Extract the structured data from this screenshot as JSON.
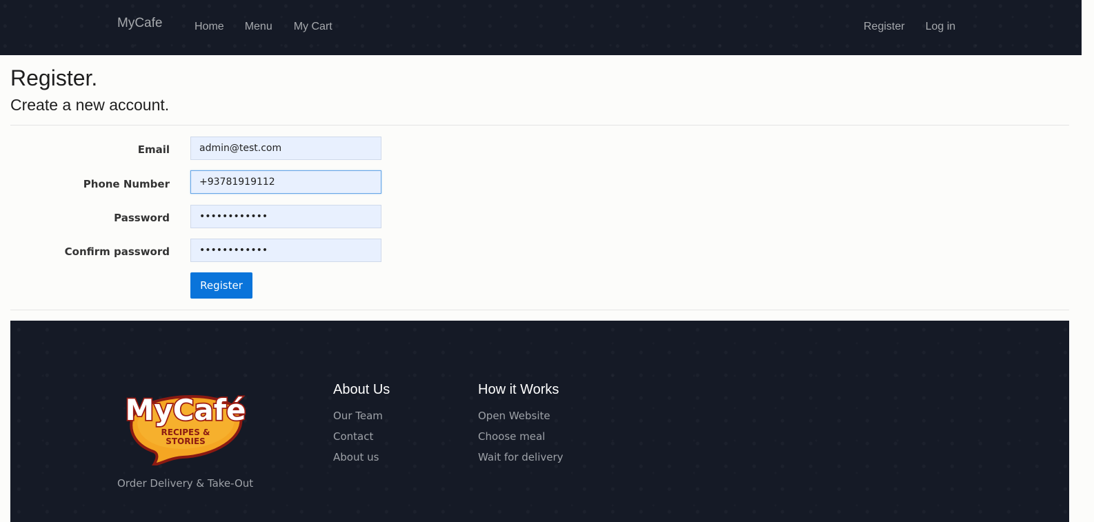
{
  "navbar": {
    "brand": "MyCafe",
    "left_links": [
      "Home",
      "Menu",
      "My Cart"
    ],
    "right_links": [
      "Register",
      "Log in"
    ]
  },
  "page": {
    "title": "Register.",
    "subtitle": "Create a new account."
  },
  "form": {
    "email": {
      "label": "Email",
      "value": "admin@test.com"
    },
    "phone": {
      "label": "Phone Number",
      "value": "+93781919112"
    },
    "password": {
      "label": "Password",
      "value": "passwords123"
    },
    "confirm": {
      "label": "Confirm password",
      "value": "passwords123"
    },
    "submit_label": "Register"
  },
  "footer": {
    "logo": {
      "title": "MyCafé",
      "subtitle_line1": "RECIPES &",
      "subtitle_line2": "STORIES"
    },
    "tagline": "Order Delivery & Take-Out",
    "about": {
      "heading": "About Us",
      "links": [
        "Our Team",
        "Contact",
        "About us"
      ]
    },
    "how": {
      "heading": "How it Works",
      "links": [
        "Open Website",
        "Choose meal",
        "Wait for delivery"
      ]
    }
  },
  "colors": {
    "nav_bg": "#151a26",
    "accent": "#0a74da",
    "input_bg": "#e8f0fe"
  }
}
